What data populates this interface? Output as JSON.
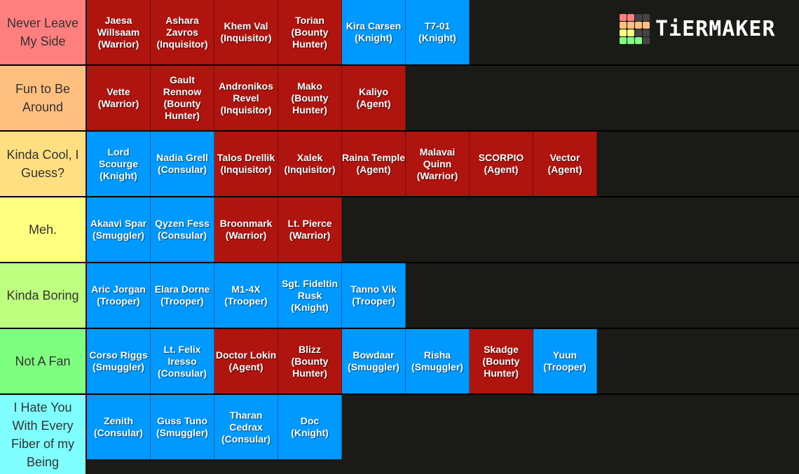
{
  "logo": {
    "text": "TiERMAKER",
    "grid_colors": [
      "#ff7f7f",
      "#ff7f7f",
      "#444444",
      "#444444",
      "#ffbf7f",
      "#ffbf7f",
      "#ffbf7f",
      "#ffbf7f",
      "#ffff7f",
      "#ffff7f",
      "#444444",
      "#444444",
      "#7fff7f",
      "#7fff7f",
      "#7fff7f",
      "#444444"
    ]
  },
  "colors": {
    "empire": "#b0140f",
    "republic": "#0099ff",
    "background": "#1a1a17"
  },
  "tiers": [
    {
      "label": "Never Leave My Side",
      "color": "#ff7f7f",
      "items": [
        {
          "name": "Jaesa Willsaam",
          "class": "Warrior",
          "faction": "empire"
        },
        {
          "name": "Ashara Zavros",
          "class": "Inquisitor",
          "faction": "empire"
        },
        {
          "name": "Khem Val",
          "class": "Inquisitor",
          "faction": "empire"
        },
        {
          "name": "Torian",
          "class": "Bounty Hunter",
          "faction": "empire"
        },
        {
          "name": "Kira Carsen",
          "class": "Knight",
          "faction": "republic"
        },
        {
          "name": "T7-01",
          "class": "Knight",
          "faction": "republic"
        }
      ]
    },
    {
      "label": "Fun to Be Around",
      "color": "#ffbf7f",
      "items": [
        {
          "name": "Vette",
          "class": "Warrior",
          "faction": "empire"
        },
        {
          "name": "Gault Rennow",
          "class": "Bounty Hunter",
          "faction": "empire"
        },
        {
          "name": "Andronikos Revel",
          "class": "Inquisitor",
          "faction": "empire"
        },
        {
          "name": "Mako",
          "class": "Bounty Hunter",
          "faction": "empire"
        },
        {
          "name": "Kaliyo",
          "class": "Agent",
          "faction": "empire"
        }
      ]
    },
    {
      "label": "Kinda Cool, I Guess?",
      "color": "#ffdf7f",
      "items": [
        {
          "name": "Lord Scourge",
          "class": "Knight",
          "faction": "republic"
        },
        {
          "name": "Nadia Grell",
          "class": "Consular",
          "faction": "republic"
        },
        {
          "name": "Talos Drellik",
          "class": "Inquisitor",
          "faction": "empire"
        },
        {
          "name": "Xalek",
          "class": "Inquisitor",
          "faction": "empire"
        },
        {
          "name": "Raina Temple",
          "class": "Agent",
          "faction": "empire"
        },
        {
          "name": "Malavai Quinn",
          "class": "Warrior",
          "faction": "empire"
        },
        {
          "name": "SCORPIO",
          "class": "Agent",
          "faction": "empire"
        },
        {
          "name": "Vector",
          "class": "Agent",
          "faction": "empire"
        }
      ]
    },
    {
      "label": "Meh.",
      "color": "#ffff7f",
      "items": [
        {
          "name": "Akaavi Spar",
          "class": "Smuggler",
          "faction": "republic"
        },
        {
          "name": "Qyzen Fess",
          "class": "Consular",
          "faction": "republic"
        },
        {
          "name": "Broonmark",
          "class": "Warrior",
          "faction": "empire"
        },
        {
          "name": "Lt. Pierce",
          "class": "Warrior",
          "faction": "empire"
        }
      ]
    },
    {
      "label": "Kinda Boring",
      "color": "#bfff7f",
      "items": [
        {
          "name": "Aric Jorgan",
          "class": "Trooper",
          "faction": "republic"
        },
        {
          "name": "Elara Dorne",
          "class": "Trooper",
          "faction": "republic"
        },
        {
          "name": "M1-4X",
          "class": "Trooper",
          "faction": "republic"
        },
        {
          "name": "Sgt. Fideltin Rusk",
          "class": "Knight",
          "faction": "republic"
        },
        {
          "name": "Tanno Vik",
          "class": "Trooper",
          "faction": "republic"
        }
      ]
    },
    {
      "label": "Not A Fan",
      "color": "#7fff7f",
      "items": [
        {
          "name": "Corso Riggs",
          "class": "Smuggler",
          "faction": "republic"
        },
        {
          "name": "Lt. Felix Iresso",
          "class": "Consular",
          "faction": "republic"
        },
        {
          "name": "Doctor Lokin",
          "class": "Agent",
          "faction": "empire"
        },
        {
          "name": "Blizz",
          "class": "Bounty Hunter",
          "faction": "empire"
        },
        {
          "name": "Bowdaar",
          "class": "Smuggler",
          "faction": "republic"
        },
        {
          "name": "Risha",
          "class": "Smuggler",
          "faction": "republic"
        },
        {
          "name": "Skadge",
          "class": "Bounty Hunter",
          "faction": "empire"
        },
        {
          "name": "Yuun",
          "class": "Trooper",
          "faction": "republic"
        }
      ]
    },
    {
      "label": "I Hate You With Every Fiber of my Being",
      "color": "#7fffff",
      "items": [
        {
          "name": "Zenith",
          "class": "Consular",
          "faction": "republic"
        },
        {
          "name": "Guss Tuno",
          "class": "Smuggler",
          "faction": "republic"
        },
        {
          "name": "Tharan Cedrax",
          "class": "Consular",
          "faction": "republic"
        },
        {
          "name": "Doc",
          "class": "Knight",
          "faction": "republic"
        }
      ]
    }
  ]
}
